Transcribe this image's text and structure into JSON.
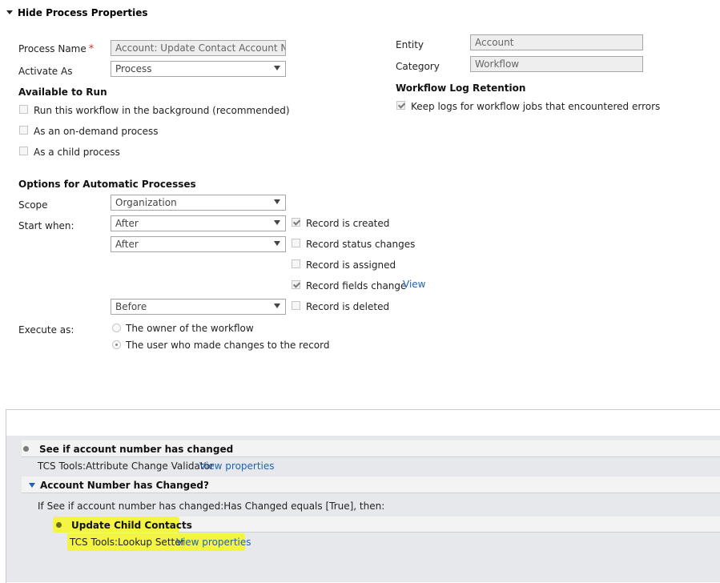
{
  "header": {
    "toggle_label": "Hide Process Properties"
  },
  "general": {
    "process_name_label": "Process Name",
    "process_name_value": "Account: Update Contact Account Numl",
    "activate_as_label": "Activate As",
    "activate_as_value": "Process",
    "entity_label": "Entity",
    "entity_value": "Account",
    "category_label": "Category",
    "category_value": "Workflow"
  },
  "available": {
    "heading": "Available to Run",
    "options": [
      {
        "label": "Run this workflow in the background (recommended)",
        "checked": false
      },
      {
        "label": "As an on-demand process",
        "checked": false
      },
      {
        "label": "As a child process",
        "checked": false
      }
    ]
  },
  "log_retention": {
    "heading": "Workflow Log Retention",
    "option_label": "Keep logs for workflow jobs that encountered errors",
    "checked": true
  },
  "automatic": {
    "heading": "Options for Automatic Processes",
    "scope_label": "Scope",
    "scope_value": "Organization",
    "start_when_label": "Start when:",
    "triggers": [
      {
        "select": "After",
        "label": "Record is created",
        "checked": true
      },
      {
        "select": "After",
        "label": "Record status changes",
        "checked": false
      },
      {
        "select": "",
        "label": "Record is assigned",
        "checked": false
      },
      {
        "select": "",
        "label": "Record fields change",
        "checked": true,
        "link": "View"
      },
      {
        "select": "Before",
        "label": "Record is deleted",
        "checked": false
      }
    ],
    "execute_as_label": "Execute as:",
    "execute_options": [
      {
        "label": "The owner of the workflow",
        "selected": false
      },
      {
        "label": "The user who made changes to the record",
        "selected": true
      }
    ]
  },
  "steps": {
    "step1_title": "See if account number has changed",
    "step1_detail": "TCS Tools:Attribute Change Validator",
    "step1_link": "View properties",
    "condition_title": "Account Number has Changed?",
    "condition_text": "If See if account number has changed:Has Changed equals [True], then:",
    "step2_title": "Update Child Contacts",
    "step2_detail": "TCS Tools:Lookup Setter",
    "step2_link": "View properties",
    "highlight_color": "#f3f542"
  }
}
